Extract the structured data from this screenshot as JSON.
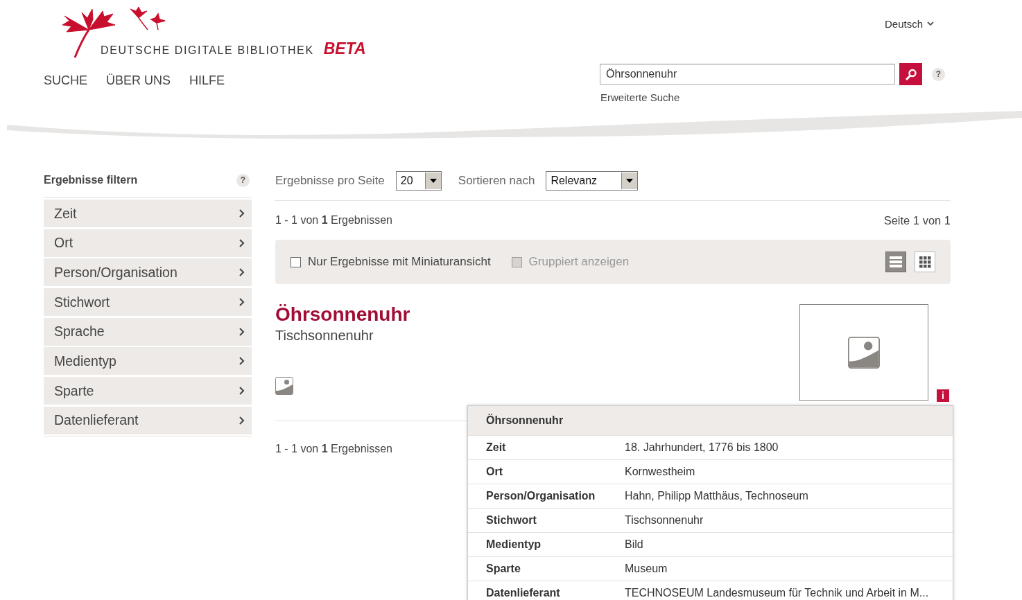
{
  "header": {
    "logo_text": "DEUTSCHE DIGITALE BIBLIOTHEK",
    "logo_badge": "BETA",
    "nav": [
      {
        "label": "SUCHE"
      },
      {
        "label": "ÜBER UNS"
      },
      {
        "label": "HILFE"
      }
    ],
    "language": "Deutsch",
    "search": {
      "value": "Öhrsonnenuhr"
    },
    "help_label": "?",
    "advanced_search": "Erweiterte Suche"
  },
  "sidebar": {
    "title": "Ergebnisse filtern",
    "help_label": "?",
    "items": [
      {
        "label": "Zeit"
      },
      {
        "label": "Ort"
      },
      {
        "label": "Person/Organisation"
      },
      {
        "label": "Stichwort"
      },
      {
        "label": "Sprache"
      },
      {
        "label": "Medientyp"
      },
      {
        "label": "Sparte"
      },
      {
        "label": "Datenlieferant"
      }
    ]
  },
  "toolbar": {
    "per_page_label": "Ergebnisse pro Seite",
    "per_page": "20",
    "sort_label": "Sortieren nach",
    "sort": "Relevanz"
  },
  "summary_top": "1 - 1 von **1** Ergebnissen",
  "page_info": "Seite 1 von 1",
  "options": [
    {
      "label": "Nur Ergebnisse mit Miniaturansicht",
      "checked": false,
      "disabled": false
    },
    {
      "label": "Gruppiert anzeigen",
      "checked": false,
      "disabled": true
    }
  ],
  "view_modes": [
    {
      "kind": "list",
      "selected": true
    },
    {
      "kind": "grid",
      "selected": false
    }
  ],
  "results": [
    {
      "title": "Öhrsonnenuhr",
      "subtitle": "Tischsonnenuhr",
      "info_label": "i"
    }
  ],
  "summary_bottom": "1 - 1 von **1** Ergebnissen",
  "popup": {
    "title": "Öhrsonnenuhr",
    "rows": [
      {
        "label": "Zeit",
        "value": "18. Jahrhundert, 1776 bis 1800"
      },
      {
        "label": "Ort",
        "value": "Kornwestheim"
      },
      {
        "label": "Person/Organisation",
        "value": "Hahn, Philipp Matthäus, Technoseum"
      },
      {
        "label": "Stichwort",
        "value": "Tischsonnenuhr"
      },
      {
        "label": "Medientyp",
        "value": "Bild"
      },
      {
        "label": "Sparte",
        "value": "Museum"
      },
      {
        "label": "Datenlieferant",
        "value": "TECHNOSEUM Landesmuseum für Technik und Arbeit in M..."
      }
    ]
  }
}
